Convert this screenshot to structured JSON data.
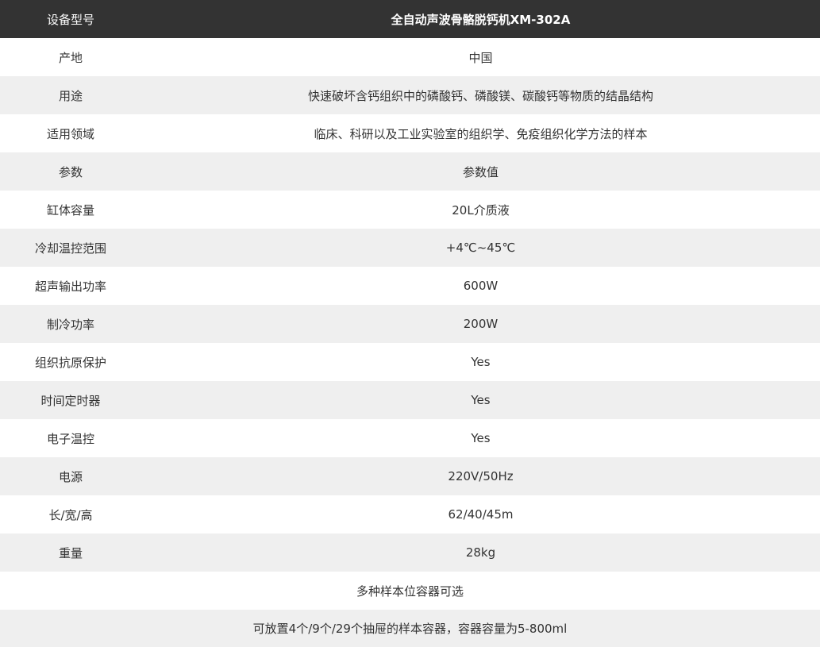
{
  "header": {
    "label": "设备型号",
    "value": "全自动声波骨骼脱钙机XM-302A"
  },
  "rows": [
    {
      "label": "产地",
      "value": "中国"
    },
    {
      "label": "用途",
      "value": "快速破坏含钙组织中的磷酸钙、磷酸镁、碳酸钙等物质的结晶结构"
    },
    {
      "label": "适用领域",
      "value": "临床、科研以及工业实验室的组织学、免疫组织化学方法的样本"
    },
    {
      "label": "参数",
      "value": "参数值"
    },
    {
      "label": "缸体容量",
      "value": "20L介质液"
    },
    {
      "label": "冷却温控范围",
      "value": "+4℃~45℃"
    },
    {
      "label": "超声输出功率",
      "value": "600W"
    },
    {
      "label": "制冷功率",
      "value": "200W"
    },
    {
      "label": "组织抗原保护",
      "value": "Yes"
    },
    {
      "label": "时间定时器",
      "value": "Yes"
    },
    {
      "label": "电子温控",
      "value": "Yes"
    },
    {
      "label": "电源",
      "value": "220V/50Hz"
    },
    {
      "label": "长/宽/高",
      "value": "62/40/45m"
    },
    {
      "label": "重量",
      "value": "28kg"
    }
  ],
  "notes": [
    "多种样本位容器可选",
    "可放置4个/9个/29个抽屉的样本容器，容器容量为5-800ml"
  ]
}
